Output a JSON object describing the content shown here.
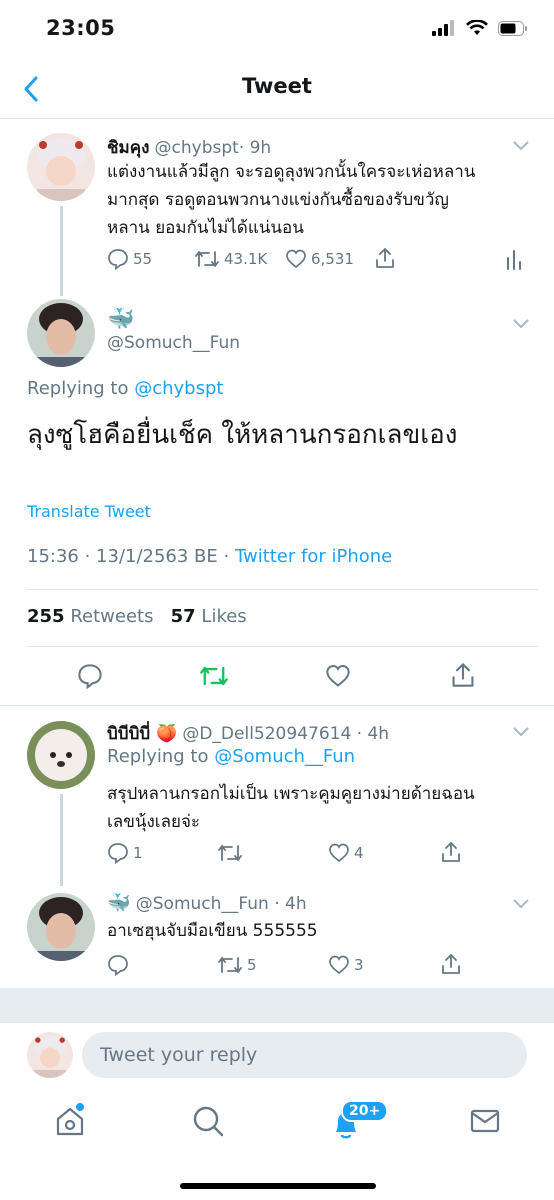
{
  "status_bar": {
    "time": "23:05"
  },
  "nav": {
    "title": "Tweet"
  },
  "parent_tweet": {
    "name": "ชิมคุง",
    "handle": "@chybspt",
    "time": "· 9h",
    "text_lines": [
      "แต่งงานแล้วมีลูก จะรอดูลุงพวกนั้นใครจะเห่อหลาน",
      "มากสุด รอดูตอนพวกนางแข่งกันซื้อของรับขวัญ",
      "หลาน ยอมกันไม่ได้แน่นอน"
    ],
    "replies": "55",
    "retweets": "43.1K",
    "likes": "6,531"
  },
  "main_tweet": {
    "handle": "@Somuch__Fun",
    "replying_label": "Replying to",
    "replying_handle": "@chybspt",
    "text": "ลุงซูโฮคือยื่นเช็ค ให้หลานกรอกเลขเอง",
    "translate": "Translate Tweet",
    "timestamp": "15:36 · 13/1/2563 BE ·",
    "source": "Twitter for iPhone",
    "retweet_count": "255",
    "retweet_label": "Retweets",
    "like_count": "57",
    "like_label": "Likes"
  },
  "reply1": {
    "name": "บิบีบิบี่ 🍑",
    "handle": "@D_Dell520947614 · 4h",
    "replying_label": "Replying to",
    "replying_handle": "@Somuch__Fun",
    "text_lines": [
      "สรุปหลานกรอกไม่เป็น เพราะคูมคูยางม่ายด้ายฉอน",
      "เลขนุ้งเลยจ่ะ"
    ],
    "replies": "1",
    "retweets": "",
    "likes": "4"
  },
  "reply2": {
    "handle": "@Somuch__Fun · 4h",
    "text": "อาเซฮุนจับมือเขียน 555555",
    "replies": "",
    "retweets": "5",
    "likes": "3"
  },
  "compose": {
    "placeholder": "Tweet your reply"
  },
  "tab_bar": {
    "notifications_badge": "20+"
  },
  "colors": {
    "accent": "#1da1f2",
    "retweet_green": "#17bf63",
    "muted": "#657786",
    "divider": "#e1e8ed"
  }
}
